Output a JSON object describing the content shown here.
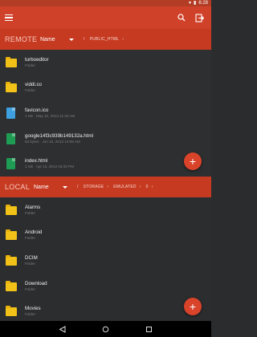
{
  "status_bar": {
    "time": "6:28"
  },
  "toolbar": {
    "menu_icon": "hamburger-menu-icon",
    "search_icon": "search-icon",
    "exit_icon": "exit-icon"
  },
  "remote": {
    "label": "REMOTE",
    "sort": "Name",
    "crumbs": [
      "/",
      "PUBLIC_HTML"
    ],
    "files": [
      {
        "name": "turboeditor",
        "meta": "Folder",
        "icon": "folder-icon"
      },
      {
        "name": "viddi.co",
        "meta": "Folder",
        "icon": "folder-icon"
      },
      {
        "name": "favicon.ico",
        "meta": "1 KB · May 10, 2013 11:40 AM",
        "icon": "file-icon"
      },
      {
        "name": "google14f3c939b149132a.html",
        "meta": "53 bytes · Jun 10, 2013 10:05 AM",
        "icon": "html-file-icon"
      },
      {
        "name": "index.html",
        "meta": "1 KB · Apr 13, 2013 03:33 PM",
        "icon": "html-file-icon"
      }
    ]
  },
  "local": {
    "label": "LOCAL",
    "sort": "Name",
    "crumbs": [
      "/",
      "STORAGE",
      "EMULATED",
      "0"
    ],
    "files": [
      {
        "name": "Alarms",
        "meta": "Folder",
        "icon": "folder-icon"
      },
      {
        "name": "Android",
        "meta": "Folder",
        "icon": "folder-icon"
      },
      {
        "name": "DCIM",
        "meta": "Folder",
        "icon": "folder-icon"
      },
      {
        "name": "Download",
        "meta": "Folder",
        "icon": "folder-icon"
      },
      {
        "name": "Movies",
        "meta": "Folder",
        "icon": "folder-icon"
      }
    ]
  },
  "fab_icon": "plus-icon",
  "colors": {
    "accent": "#d0412a",
    "header": "#c73a22",
    "folder": "#f2c218",
    "html_file": "#1e9c54",
    "ico_file": "#3ea0e0"
  }
}
